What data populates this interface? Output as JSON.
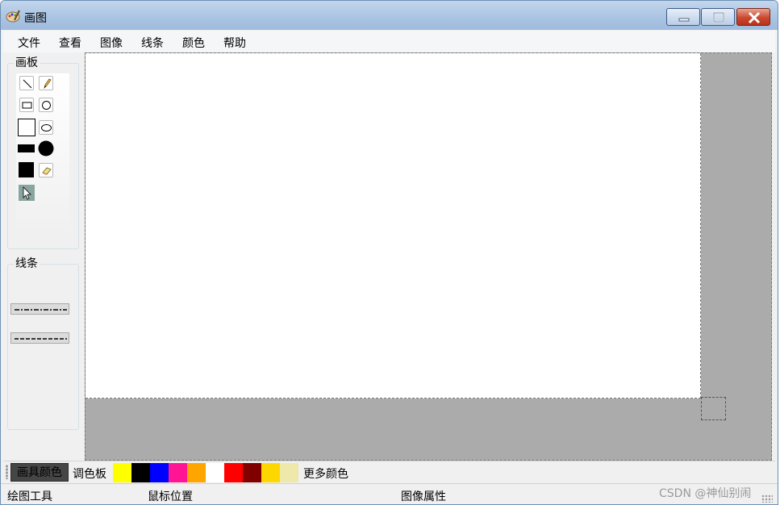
{
  "window": {
    "title": "画图"
  },
  "menu": [
    "文件",
    "查看",
    "图像",
    "线条",
    "颜色",
    "帮助"
  ],
  "panel": {
    "board_label": "画板",
    "line_label": "线条",
    "tools": [
      "line-tool",
      "pencil-tool",
      "rectangle-tool",
      "circle-tool",
      "large-rectangle-tool",
      "ellipse-tool",
      "filled-rectangle-tool",
      "filled-circle-tool",
      "filled-square-tool",
      "eraser-tool",
      "pointer-tool"
    ],
    "selected_tool": "pointer-tool"
  },
  "colorbar": {
    "current_color_label": "画具颜色",
    "current_color": "#464646",
    "palette_label": "调色板",
    "swatches": [
      "#ffff00",
      "#000000",
      "#0000ff",
      "#ff1493",
      "#ffa500",
      "#ffffff",
      "#ff0000",
      "#800000",
      "#ffd700",
      "#eee8aa"
    ],
    "more_colors_label": "更多颜色"
  },
  "status": {
    "tool": "绘图工具",
    "mouse_position": "鼠标位置",
    "image_properties": "图像属性"
  },
  "watermark": "CSDN @神仙别闹"
}
